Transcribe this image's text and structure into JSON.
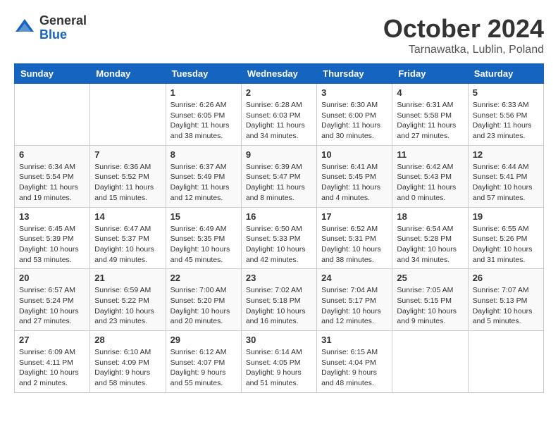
{
  "header": {
    "logo_general": "General",
    "logo_blue": "Blue",
    "month": "October 2024",
    "location": "Tarnawatka, Lublin, Poland"
  },
  "days_of_week": [
    "Sunday",
    "Monday",
    "Tuesday",
    "Wednesday",
    "Thursday",
    "Friday",
    "Saturday"
  ],
  "weeks": [
    [
      {
        "day": "",
        "detail": ""
      },
      {
        "day": "",
        "detail": ""
      },
      {
        "day": "1",
        "detail": "Sunrise: 6:26 AM\nSunset: 6:05 PM\nDaylight: 11 hours and 38 minutes."
      },
      {
        "day": "2",
        "detail": "Sunrise: 6:28 AM\nSunset: 6:03 PM\nDaylight: 11 hours and 34 minutes."
      },
      {
        "day": "3",
        "detail": "Sunrise: 6:30 AM\nSunset: 6:00 PM\nDaylight: 11 hours and 30 minutes."
      },
      {
        "day": "4",
        "detail": "Sunrise: 6:31 AM\nSunset: 5:58 PM\nDaylight: 11 hours and 27 minutes."
      },
      {
        "day": "5",
        "detail": "Sunrise: 6:33 AM\nSunset: 5:56 PM\nDaylight: 11 hours and 23 minutes."
      }
    ],
    [
      {
        "day": "6",
        "detail": "Sunrise: 6:34 AM\nSunset: 5:54 PM\nDaylight: 11 hours and 19 minutes."
      },
      {
        "day": "7",
        "detail": "Sunrise: 6:36 AM\nSunset: 5:52 PM\nDaylight: 11 hours and 15 minutes."
      },
      {
        "day": "8",
        "detail": "Sunrise: 6:37 AM\nSunset: 5:49 PM\nDaylight: 11 hours and 12 minutes."
      },
      {
        "day": "9",
        "detail": "Sunrise: 6:39 AM\nSunset: 5:47 PM\nDaylight: 11 hours and 8 minutes."
      },
      {
        "day": "10",
        "detail": "Sunrise: 6:41 AM\nSunset: 5:45 PM\nDaylight: 11 hours and 4 minutes."
      },
      {
        "day": "11",
        "detail": "Sunrise: 6:42 AM\nSunset: 5:43 PM\nDaylight: 11 hours and 0 minutes."
      },
      {
        "day": "12",
        "detail": "Sunrise: 6:44 AM\nSunset: 5:41 PM\nDaylight: 10 hours and 57 minutes."
      }
    ],
    [
      {
        "day": "13",
        "detail": "Sunrise: 6:45 AM\nSunset: 5:39 PM\nDaylight: 10 hours and 53 minutes."
      },
      {
        "day": "14",
        "detail": "Sunrise: 6:47 AM\nSunset: 5:37 PM\nDaylight: 10 hours and 49 minutes."
      },
      {
        "day": "15",
        "detail": "Sunrise: 6:49 AM\nSunset: 5:35 PM\nDaylight: 10 hours and 45 minutes."
      },
      {
        "day": "16",
        "detail": "Sunrise: 6:50 AM\nSunset: 5:33 PM\nDaylight: 10 hours and 42 minutes."
      },
      {
        "day": "17",
        "detail": "Sunrise: 6:52 AM\nSunset: 5:31 PM\nDaylight: 10 hours and 38 minutes."
      },
      {
        "day": "18",
        "detail": "Sunrise: 6:54 AM\nSunset: 5:28 PM\nDaylight: 10 hours and 34 minutes."
      },
      {
        "day": "19",
        "detail": "Sunrise: 6:55 AM\nSunset: 5:26 PM\nDaylight: 10 hours and 31 minutes."
      }
    ],
    [
      {
        "day": "20",
        "detail": "Sunrise: 6:57 AM\nSunset: 5:24 PM\nDaylight: 10 hours and 27 minutes."
      },
      {
        "day": "21",
        "detail": "Sunrise: 6:59 AM\nSunset: 5:22 PM\nDaylight: 10 hours and 23 minutes."
      },
      {
        "day": "22",
        "detail": "Sunrise: 7:00 AM\nSunset: 5:20 PM\nDaylight: 10 hours and 20 minutes."
      },
      {
        "day": "23",
        "detail": "Sunrise: 7:02 AM\nSunset: 5:18 PM\nDaylight: 10 hours and 16 minutes."
      },
      {
        "day": "24",
        "detail": "Sunrise: 7:04 AM\nSunset: 5:17 PM\nDaylight: 10 hours and 12 minutes."
      },
      {
        "day": "25",
        "detail": "Sunrise: 7:05 AM\nSunset: 5:15 PM\nDaylight: 10 hours and 9 minutes."
      },
      {
        "day": "26",
        "detail": "Sunrise: 7:07 AM\nSunset: 5:13 PM\nDaylight: 10 hours and 5 minutes."
      }
    ],
    [
      {
        "day": "27",
        "detail": "Sunrise: 6:09 AM\nSunset: 4:11 PM\nDaylight: 10 hours and 2 minutes."
      },
      {
        "day": "28",
        "detail": "Sunrise: 6:10 AM\nSunset: 4:09 PM\nDaylight: 9 hours and 58 minutes."
      },
      {
        "day": "29",
        "detail": "Sunrise: 6:12 AM\nSunset: 4:07 PM\nDaylight: 9 hours and 55 minutes."
      },
      {
        "day": "30",
        "detail": "Sunrise: 6:14 AM\nSunset: 4:05 PM\nDaylight: 9 hours and 51 minutes."
      },
      {
        "day": "31",
        "detail": "Sunrise: 6:15 AM\nSunset: 4:04 PM\nDaylight: 9 hours and 48 minutes."
      },
      {
        "day": "",
        "detail": ""
      },
      {
        "day": "",
        "detail": ""
      }
    ]
  ]
}
